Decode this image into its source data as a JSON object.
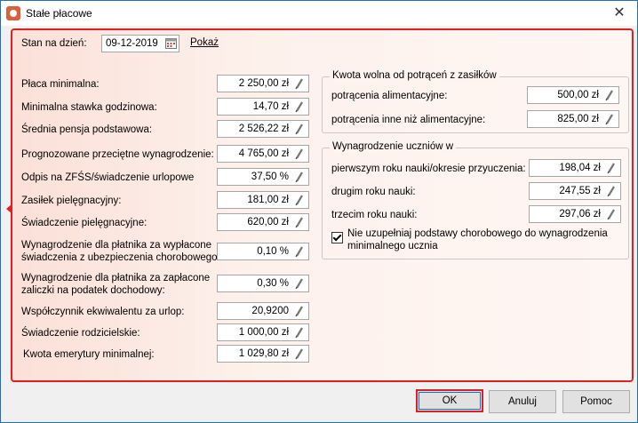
{
  "window": {
    "title": "Stałe płacowe",
    "close_glyph": "✕"
  },
  "header": {
    "date_label": "Stan na dzień:",
    "date_value": "09-12-2019",
    "show_link": "Pokaż"
  },
  "left_rows": [
    {
      "label": "Płaca minimalna:",
      "value": "2 250,00 zł"
    },
    {
      "label": "Minimalna stawka godzinowa:",
      "value": "14,70 zł"
    },
    {
      "label": "Średnia pensja podstawowa:",
      "value": "2 526,22 zł"
    },
    {
      "label": "Prognozowane przeciętne wynagrodzenie:",
      "value": "4 765,00 zł"
    },
    {
      "label": "Odpis na ZFŚS/świadczenie urlopowe",
      "value": "37,50 %"
    },
    {
      "label": "Zasiłek pielęgnacyjny:",
      "value": "181,00 zł"
    },
    {
      "label": "Świadczenie pielęgnacyjne:",
      "value": "620,00 zł"
    },
    {
      "label": "Wynagrodzenie dla płatnika za wypłacone",
      "label2": "świadczenia z ubezpieczenia chorobowego:",
      "value": "0,10 %"
    },
    {
      "label": "Wynagrodzenie dla płatnika za zapłacone",
      "label2": "zaliczki na podatek dochodowy:",
      "value": "0,30 %"
    },
    {
      "label": "Współczynnik ekwiwalentu za urlop:",
      "value": "20,9200"
    },
    {
      "label": "Świadczenie rodzicielskie:",
      "value": "1 000,00 zł"
    },
    {
      "label": "Kwota emerytury minimalnej:",
      "value": "1 029,80 zł"
    }
  ],
  "group1": {
    "title": "Kwota wolna od potrąceń z zasiłków",
    "rows": [
      {
        "label": "potrącenia alimentacyjne:",
        "value": "500,00 zł"
      },
      {
        "label": "potrącenia inne niż alimentacyjne:",
        "value": "825,00 zł"
      }
    ]
  },
  "group2": {
    "title": "Wynagrodzenie uczniów w",
    "rows": [
      {
        "label": "pierwszym roku nauki/okresie przyuczenia:",
        "value": "198,04 zł"
      },
      {
        "label": "drugim roku nauki:",
        "value": "247,55 zł"
      },
      {
        "label": "trzecim roku nauki:",
        "value": "297,06 zł"
      }
    ],
    "checkbox_line1": "Nie uzupełniaj podstawy chorobowego do wynagrodzenia",
    "checkbox_line2": "minimalnego ucznia",
    "checkbox_checked": true
  },
  "buttons": {
    "ok": "OK",
    "cancel": "Anuluj",
    "help": "Pomoc"
  },
  "colors": {
    "accent": "#e02020",
    "focus": "#0078d7"
  }
}
